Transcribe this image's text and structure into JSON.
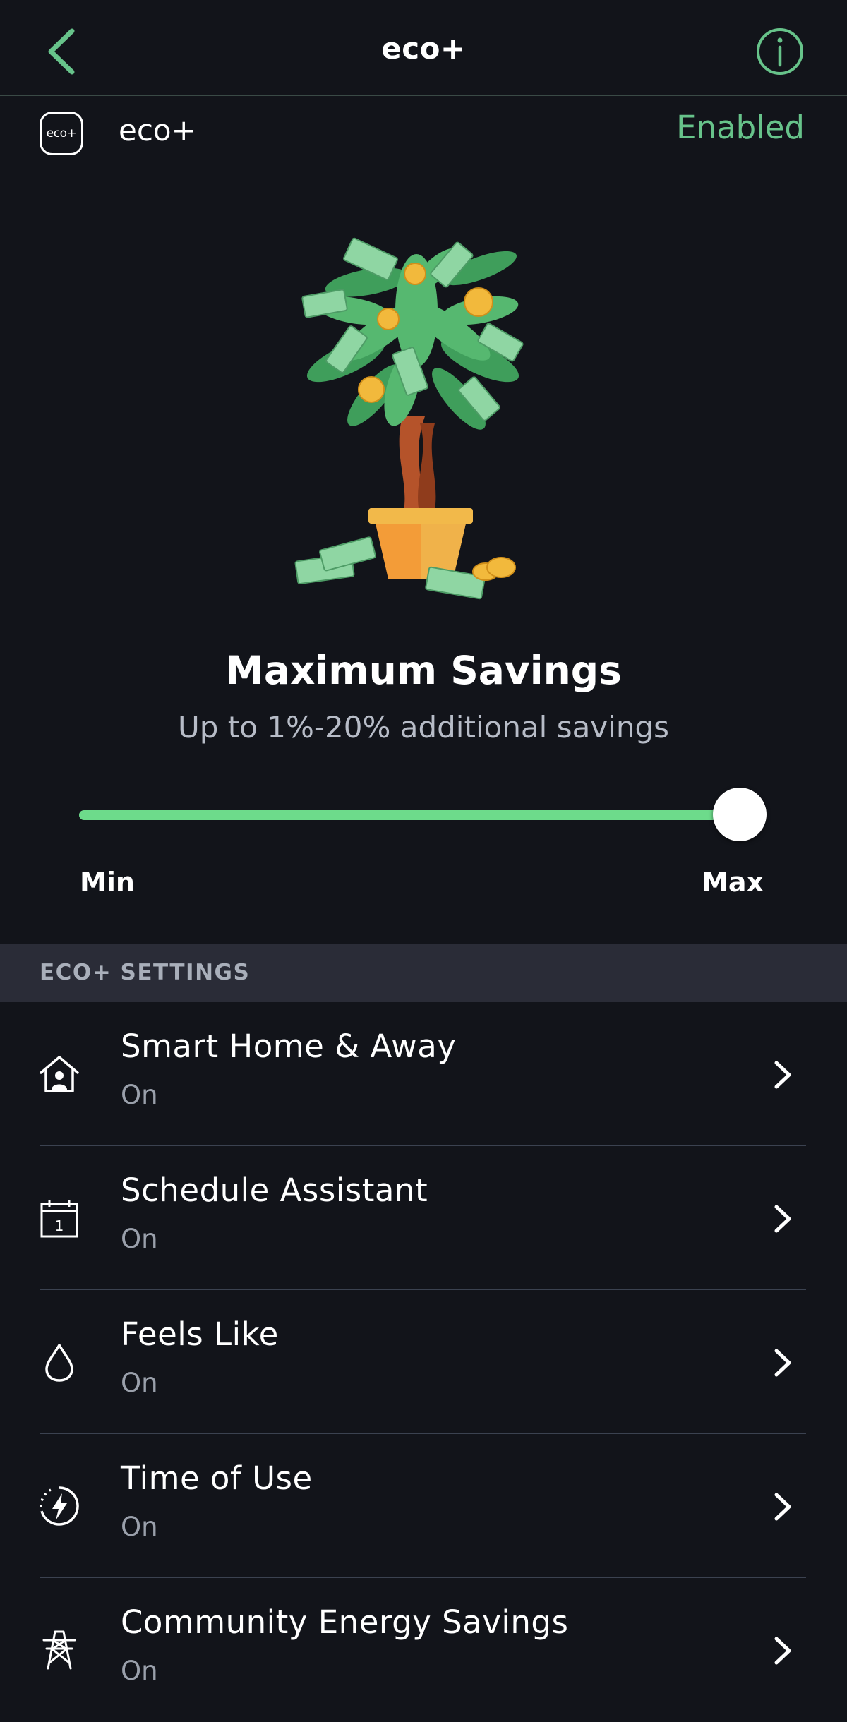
{
  "header": {
    "title": "eco+",
    "back_icon": "chevron-left-icon",
    "info_icon": "info-icon",
    "accent_color": "#67c38a"
  },
  "eco_row": {
    "logo_text": "eco+",
    "name": "eco+",
    "status": "Enabled"
  },
  "savings": {
    "illustration": "money-tree-illustration",
    "headline": "Maximum Savings",
    "subline": "Up to 1%-20% additional savings",
    "slider": {
      "min_label": "Min",
      "max_label": "Max",
      "value_fraction": 1.0,
      "track_color": "#6ddb8b"
    }
  },
  "settings": {
    "section_title": "ECO+ SETTINGS",
    "items": [
      {
        "title": "Smart Home & Away",
        "status": "On",
        "icon": "home-person-icon"
      },
      {
        "title": "Schedule Assistant",
        "status": "On",
        "icon": "calendar-icon"
      },
      {
        "title": "Feels Like",
        "status": "On",
        "icon": "droplet-icon"
      },
      {
        "title": "Time of Use",
        "status": "On",
        "icon": "lightning-clock-icon"
      },
      {
        "title": "Community Energy Savings",
        "status": "On",
        "icon": "power-tower-icon"
      }
    ]
  }
}
